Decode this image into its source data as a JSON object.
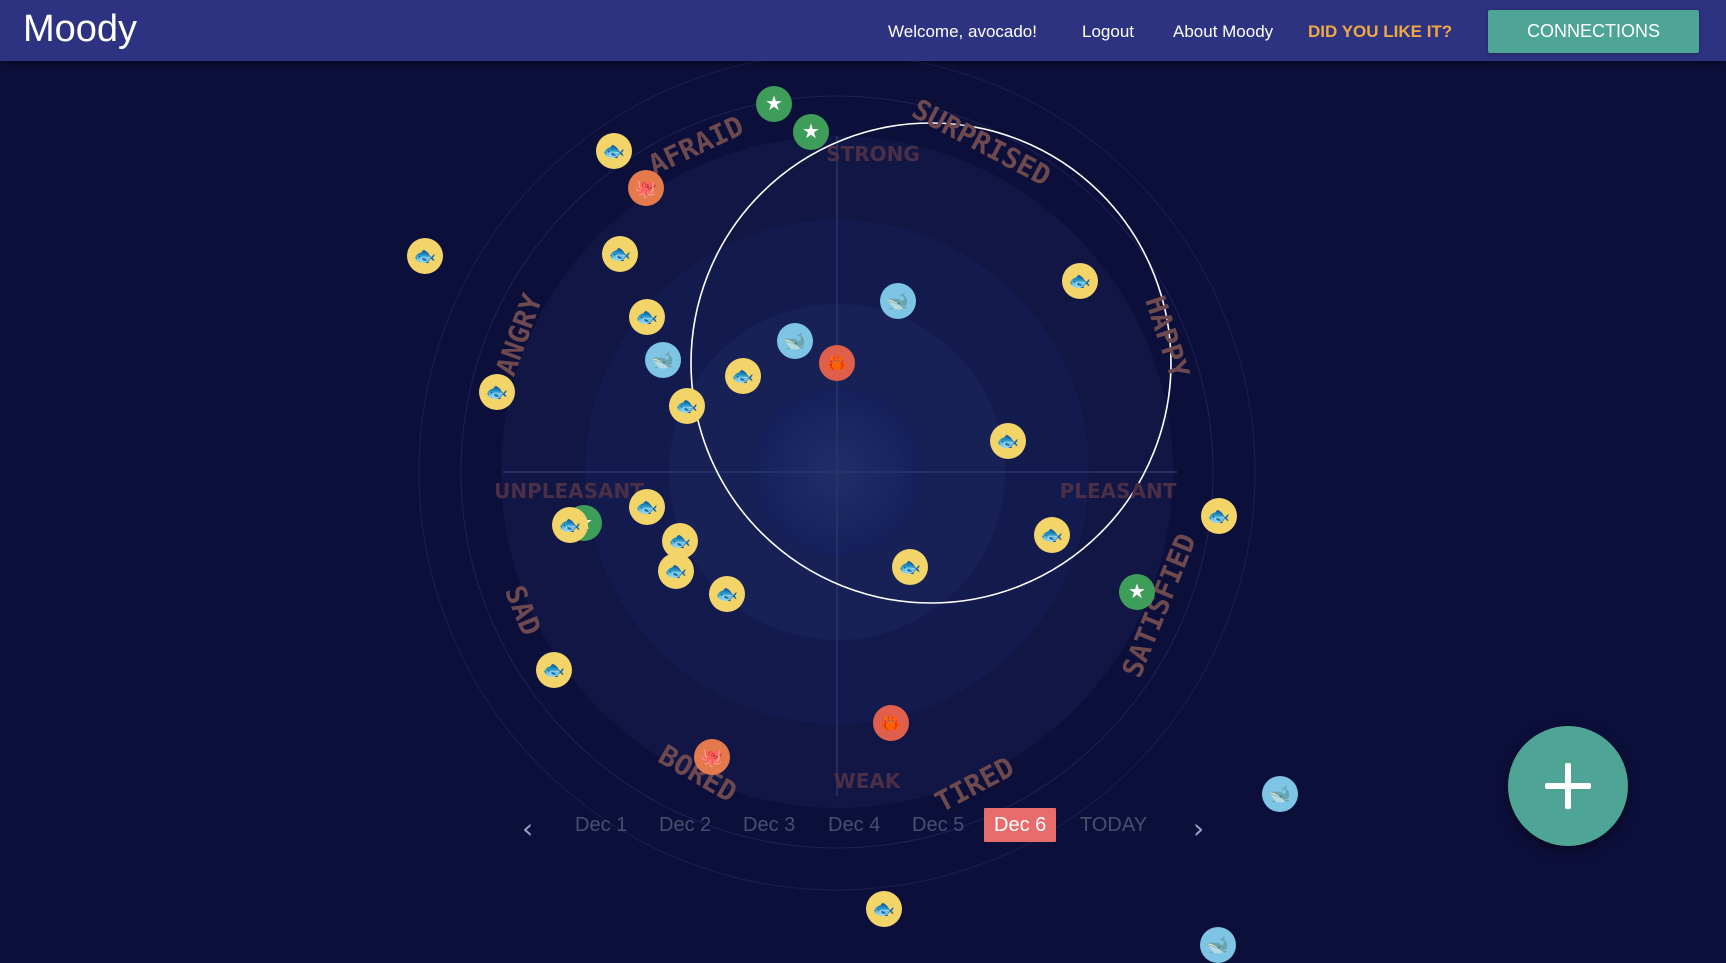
{
  "app": {
    "title": "Moody"
  },
  "nav": {
    "welcome": "Welcome, avocado!",
    "logout": "Logout",
    "about": "About Moody",
    "feedback": "DID YOU LIKE IT?",
    "connections": "CONNECTIONS"
  },
  "emotions": {
    "afraid": "AFRAID",
    "surprised": "SURPRISED",
    "angry": "ANGRY",
    "happy": "HAPPY",
    "sad": "SAD",
    "satisfied": "SATISFIED",
    "bored": "BORED",
    "tired": "TIRED"
  },
  "axes": {
    "strong": "STRONG",
    "weak": "WEAK",
    "unpleasant": "UNPLEASANT",
    "pleasant": "PLEASANT"
  },
  "dates": {
    "prev": "‹",
    "next": "›",
    "items": [
      "Dec 1",
      "Dec 2",
      "Dec 3",
      "Dec 4",
      "Dec 5",
      "Dec 6",
      "TODAY"
    ],
    "selected": "Dec 6"
  },
  "fab": {
    "icon": "plus-icon"
  },
  "colors": {
    "background": "#0d0f3b",
    "header": "#2e3381",
    "accent": "#4ea596",
    "feedback": "#f0a845",
    "selected_date": "#e96c6c",
    "fish": "#f3d468",
    "whale": "#7ec4e4",
    "crab": "#df5f4c",
    "starfish": "#3f9d5a",
    "octopus": "#e47a4b"
  },
  "mood_icons": {
    "fish": "fish-icon",
    "whale": "whale-icon",
    "crab": "crab-icon",
    "starfish": "starfish-icon",
    "octopus": "octopus-icon"
  }
}
